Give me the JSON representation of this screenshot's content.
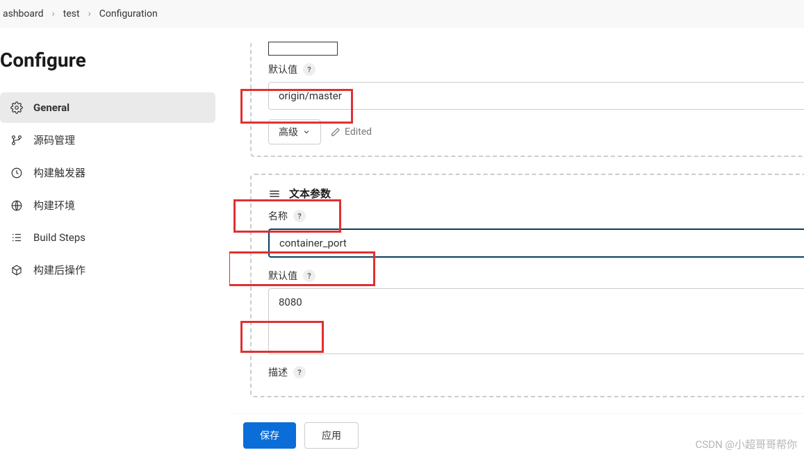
{
  "breadcrumb": {
    "items": [
      "ashboard",
      "test",
      "Configuration"
    ]
  },
  "page_title": "Configure",
  "sidebar": {
    "items": [
      {
        "label": "General"
      },
      {
        "label": "源码管理"
      },
      {
        "label": "构建触发器"
      },
      {
        "label": "构建环境"
      },
      {
        "label": "Build Steps"
      },
      {
        "label": "构建后操作"
      }
    ]
  },
  "section1": {
    "default_label": "默认值",
    "default_value": "origin/master",
    "advanced_label": "高级",
    "edited_label": "Edited"
  },
  "section2": {
    "header": "文本参数",
    "name_label": "名称",
    "name_value": "container_port",
    "default_label": "默认值",
    "default_value": "8080",
    "desc_label": "描述"
  },
  "footer": {
    "save": "保存",
    "apply": "应用"
  },
  "watermark": "CSDN @小超哥哥帮你"
}
